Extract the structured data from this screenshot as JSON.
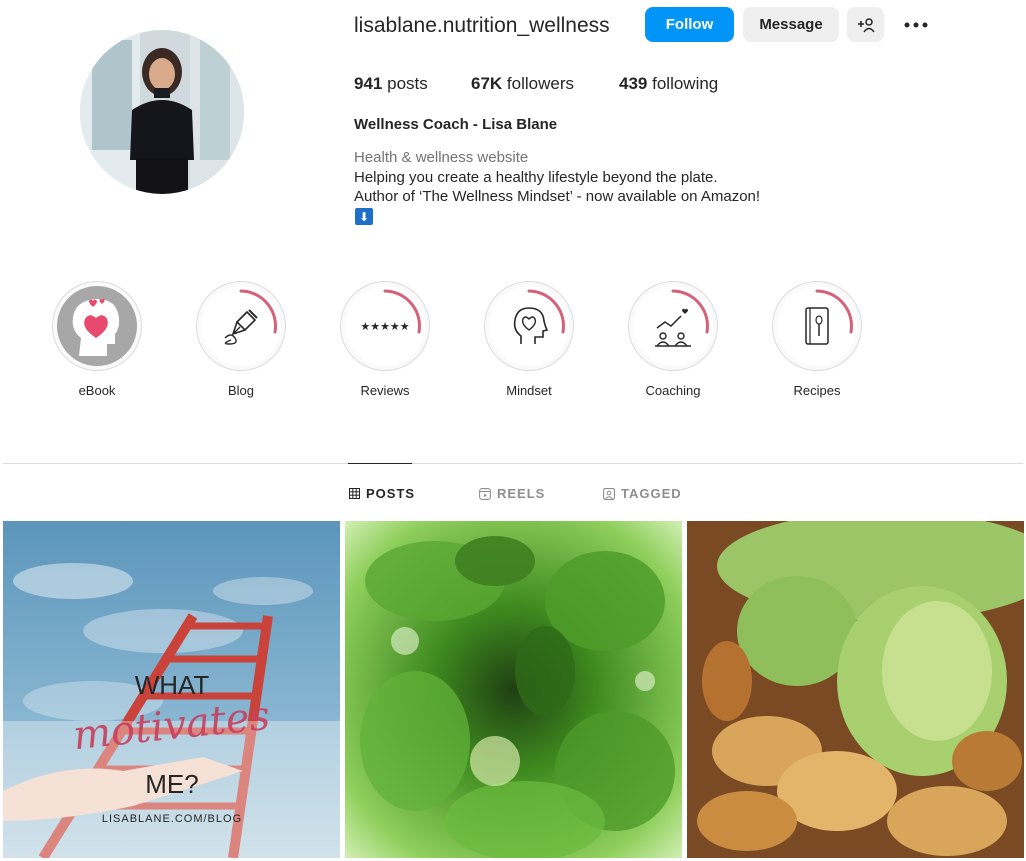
{
  "profile": {
    "username": "lisablane.nutrition_wellness",
    "follow_label": "Follow",
    "message_label": "Message",
    "stats": {
      "posts_count": "941",
      "posts_label": "posts",
      "followers_count": "67K",
      "followers_label": "followers",
      "following_count": "439",
      "following_label": "following"
    },
    "full_name": "Wellness Coach - Lisa Blane",
    "category": "Health & wellness website",
    "bio_line1": "Helping you create a healthy lifestyle beyond the plate.",
    "bio_line2": "Author of ‘The Wellness Mindset’ - now available on Amazon!",
    "bio_emoji": "⬇"
  },
  "highlights": [
    {
      "label": "eBook",
      "icon": "head-heart-icon"
    },
    {
      "label": "Blog",
      "icon": "pen-nib-icon"
    },
    {
      "label": "Reviews",
      "icon": "five-stars-icon"
    },
    {
      "label": "Mindset",
      "icon": "head-outline-heart-icon"
    },
    {
      "label": "Coaching",
      "icon": "coaching-icon"
    },
    {
      "label": "Recipes",
      "icon": "recipe-book-icon"
    }
  ],
  "tabs": [
    {
      "label": "POSTS",
      "icon": "grid-icon",
      "active": true
    },
    {
      "label": "REELS",
      "icon": "reels-icon",
      "active": false
    },
    {
      "label": "TAGGED",
      "icon": "tagged-icon",
      "active": false
    }
  ],
  "posts": [
    {
      "overlay_line1": "WHAT",
      "overlay_script": "motivates",
      "overlay_line2": "ME?",
      "overlay_url": "LISABLANE.COM/BLOG"
    },
    {
      "description": "green smoothie"
    },
    {
      "description": "avocado scramble"
    }
  ],
  "colors": {
    "follow_button": "#0095f6",
    "highlight_accent": "#d6607a",
    "text": "#262626",
    "muted": "#737373"
  }
}
